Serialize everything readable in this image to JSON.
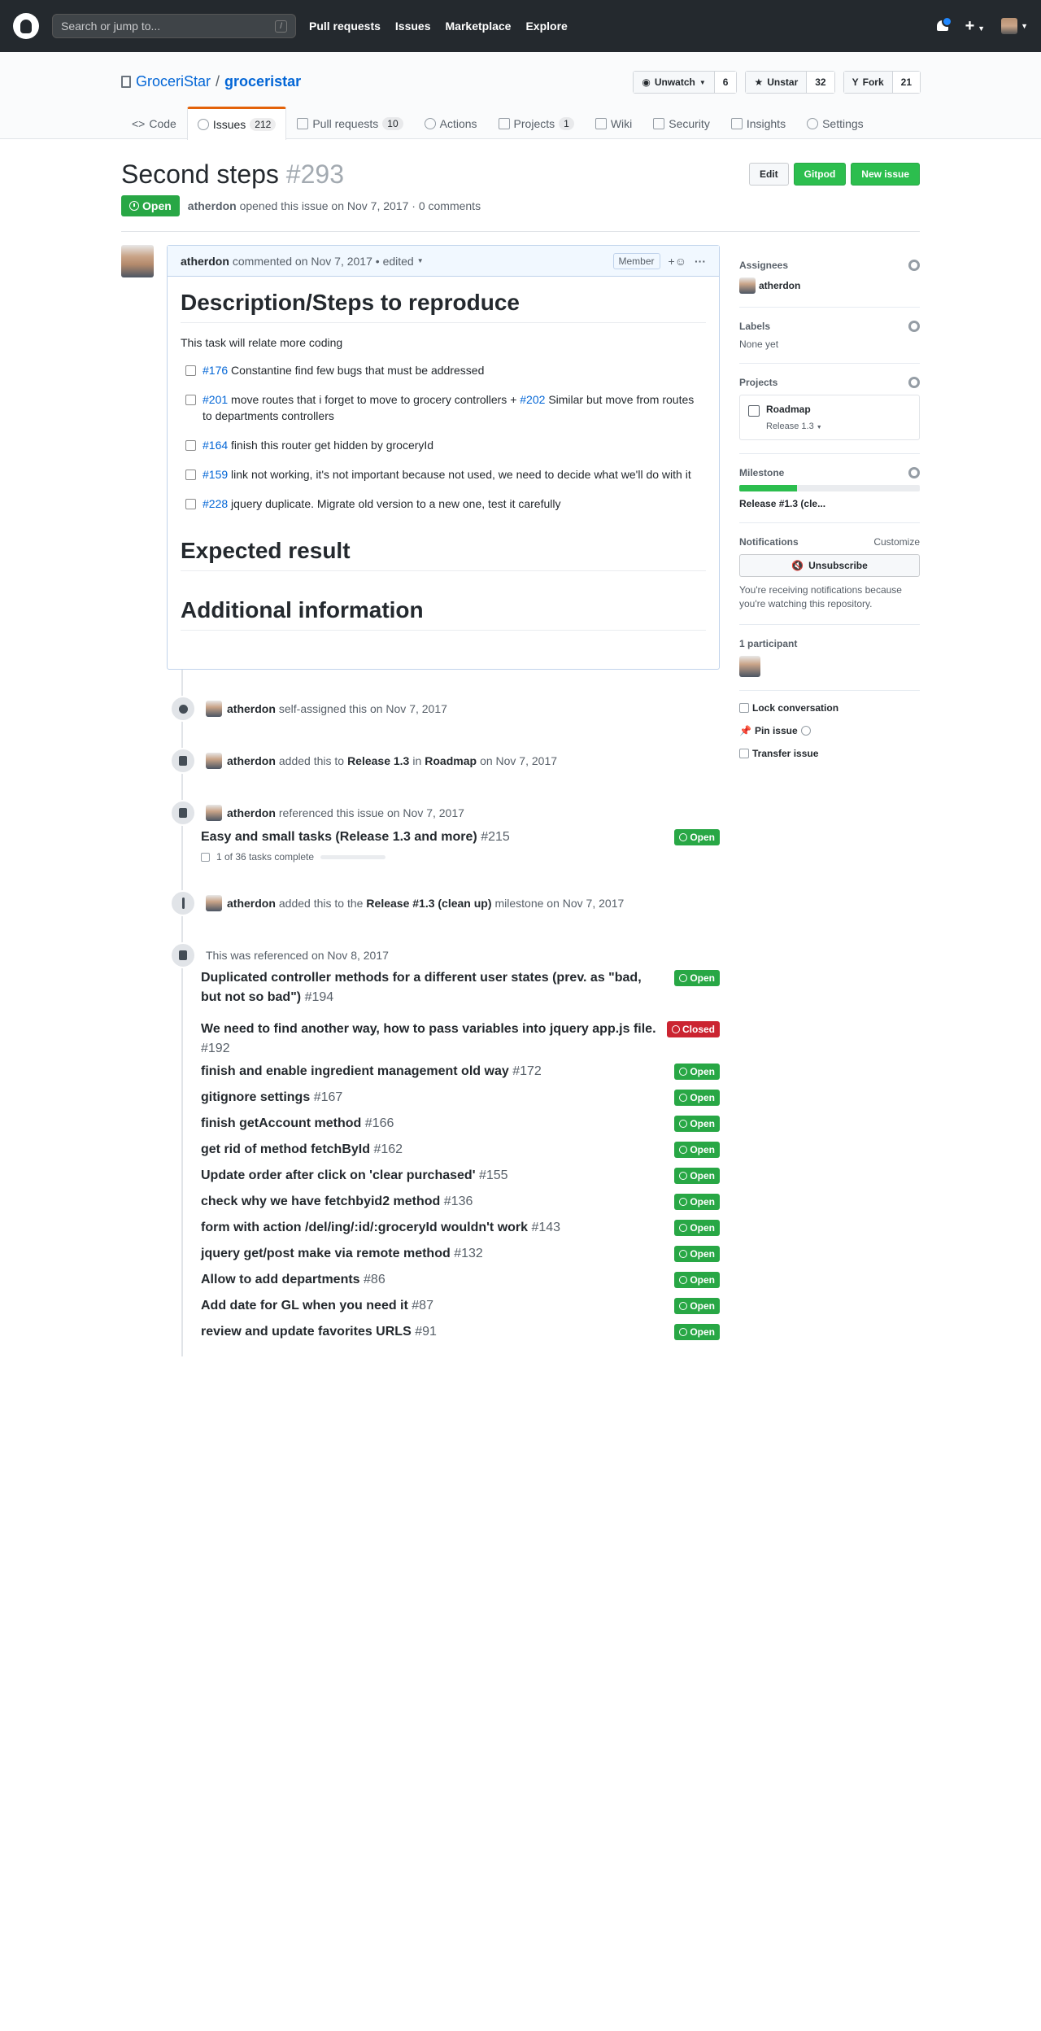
{
  "header": {
    "search_placeholder": "Search or jump to...",
    "search_shortcut": "/",
    "nav": [
      "Pull requests",
      "Issues",
      "Marketplace",
      "Explore"
    ],
    "plus": "+"
  },
  "repo": {
    "owner": "GroceriStar",
    "separator": "/",
    "name": "groceristar",
    "watch_label": "Unwatch",
    "watch_count": "6",
    "star_label": "Unstar",
    "star_count": "32",
    "fork_label": "Fork",
    "fork_count": "21"
  },
  "tabs": {
    "code": "Code",
    "issues": "Issues",
    "issues_count": "212",
    "pulls": "Pull requests",
    "pulls_count": "10",
    "actions": "Actions",
    "projects": "Projects",
    "projects_count": "1",
    "wiki": "Wiki",
    "security": "Security",
    "insights": "Insights",
    "settings": "Settings"
  },
  "issue": {
    "title": "Second steps",
    "number": "#293",
    "edit": "Edit",
    "gitpod": "Gitpod",
    "new_issue": "New issue",
    "state": "Open",
    "author": "atherdon",
    "meta_text": "opened this issue on Nov 7, 2017 · 0 comments"
  },
  "comment": {
    "author": "atherdon",
    "meta": "commented on Nov 7, 2017 • edited",
    "member": "Member",
    "h_description": "Description/Steps to reproduce",
    "intro": "This task will relate more coding",
    "tasks": [
      {
        "ref": "#176",
        "text": "Constantine find few bugs that must be addressed",
        "ref2": "",
        "text2": ""
      },
      {
        "ref": "#201",
        "text": "move routes that i forget to move to grocery controllers + ",
        "ref2": "#202",
        "text2": "Similar but move from routes to departments controllers"
      },
      {
        "ref": "#164",
        "text": "finish this router get hidden by groceryId",
        "ref2": "",
        "text2": ""
      },
      {
        "ref": "#159",
        "text": "link not working, it's not important because not used, we need to decide what we'll do with it",
        "ref2": "",
        "text2": ""
      },
      {
        "ref": "#228",
        "text": "jquery duplicate. Migrate old version to a new one, test it carefully",
        "ref2": "",
        "text2": ""
      }
    ],
    "h_expected": "Expected result",
    "h_additional": "Additional information"
  },
  "timeline": {
    "assigned": {
      "user": "atherdon",
      "text": "self-assigned this on Nov 7, 2017"
    },
    "project": {
      "user": "atherdon",
      "text1": "added this to",
      "release": "Release 1.3",
      "text2": "in",
      "project": "Roadmap",
      "text3": "on Nov 7, 2017"
    },
    "referenced": {
      "user": "atherdon",
      "text": "referenced this issue on Nov 7, 2017",
      "ref_title": "Easy and small tasks (Release 1.3 and more)",
      "ref_num": "#215",
      "ref_state": "Open",
      "tasks": "1 of 36 tasks complete"
    },
    "milestone": {
      "user": "atherdon",
      "text1": "added this to the",
      "milestone": "Release #1.3 (clean up)",
      "text2": "milestone on Nov 7, 2017"
    },
    "cross_ref_header": "This was referenced on Nov 8, 2017",
    "cross_refs": [
      {
        "title": "Duplicated controller methods for a different user states (prev. as \"bad, but not so bad\")",
        "num": "#194",
        "state": "Open"
      },
      {
        "title": "We need to find another way, how to pass variables into jquery app.js file.",
        "num": "#192",
        "state": "Closed"
      },
      {
        "title": "finish and enable ingredient management old way",
        "num": "#172",
        "state": "Open"
      },
      {
        "title": "gitignore settings",
        "num": "#167",
        "state": "Open"
      },
      {
        "title": "finish getAccount method",
        "num": "#166",
        "state": "Open"
      },
      {
        "title": "get rid of method fetchById",
        "num": "#162",
        "state": "Open"
      },
      {
        "title": "Update order after click on 'clear purchased'",
        "num": "#155",
        "state": "Open"
      },
      {
        "title": "check why we have fetchbyid2 method",
        "num": "#136",
        "state": "Open"
      },
      {
        "title": "form with action /del/ing/:id/:groceryId wouldn't work",
        "num": "#143",
        "state": "Open"
      },
      {
        "title": "jquery get/post make via remote method",
        "num": "#132",
        "state": "Open"
      },
      {
        "title": "Allow to add departments",
        "num": "#86",
        "state": "Open"
      },
      {
        "title": "Add date for GL when you need it",
        "num": "#87",
        "state": "Open"
      },
      {
        "title": "review and update favorites URLS",
        "num": "#91",
        "state": "Open"
      }
    ]
  },
  "sidebar": {
    "assignees": "Assignees",
    "assignee": "atherdon",
    "labels": "Labels",
    "labels_value": "None yet",
    "projects": "Projects",
    "project_name": "Roadmap",
    "project_column": "Release 1.3",
    "milestone": "Milestone",
    "milestone_value": "Release #1.3 (cle...",
    "milestone_progress": 0.32,
    "notifications": "Notifications",
    "customize": "Customize",
    "unsubscribe": "Unsubscribe",
    "notif_text": "You're receiving notifications because you're watching this repository.",
    "participants": "1 participant",
    "lock": "Lock conversation",
    "pin": "Pin issue",
    "transfer": "Transfer issue"
  }
}
